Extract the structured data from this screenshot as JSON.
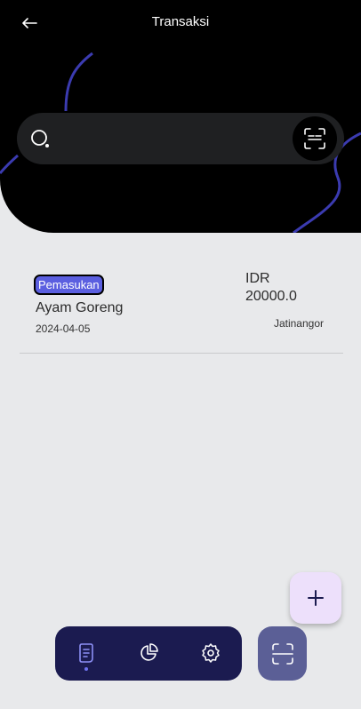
{
  "header": {
    "title": "Transaksi",
    "back_icon": "arrow-left-icon"
  },
  "search": {
    "value": "",
    "placeholder": "",
    "icon": "search-icon",
    "scan_icon": "scan-icon"
  },
  "transactions": [
    {
      "type": "Pemasukan",
      "name": "Ayam Goreng",
      "date": "2024-04-05",
      "currency": "IDR",
      "amount": "20000.0",
      "location": "Jatinangor"
    }
  ],
  "fab": {
    "icon": "plus-icon"
  },
  "bottom_nav": {
    "items": [
      {
        "icon": "transactions-icon",
        "active": true
      },
      {
        "icon": "chart-icon",
        "active": false
      },
      {
        "icon": "settings-icon",
        "active": false
      }
    ],
    "scan_icon": "scan-icon"
  },
  "colors": {
    "header_bg": "#000000",
    "accent": "#5b5fe0",
    "deco_line": "#3b3bb0",
    "nav_bg": "#1b1b50",
    "scan_nav_bg": "#5b5f96",
    "fab_bg": "#ede0fb",
    "page_bg": "#e8e9eb"
  }
}
